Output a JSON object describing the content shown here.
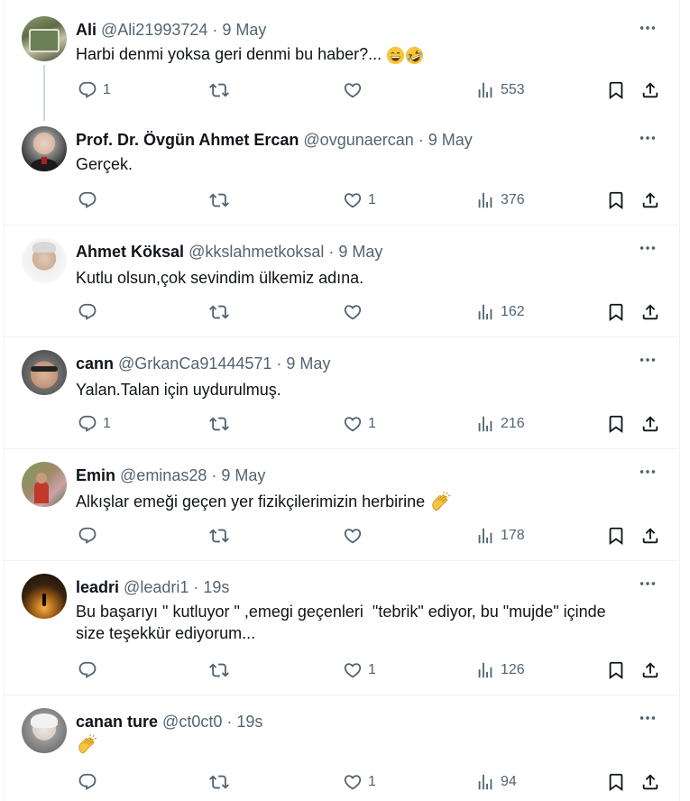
{
  "tweets": [
    {
      "name": "Ali",
      "handle": "@Ali21993724",
      "dot": " · ",
      "time": "9 May",
      "text": "Harbi denmi yoksa geri denmi bu haber?...",
      "emojis": [
        "grinning-face",
        "rolling-laughing-face"
      ],
      "stats": {
        "replies": "1",
        "retweets": "",
        "likes": "",
        "views": "553"
      }
    },
    {
      "name": "Prof. Dr. Övgün Ahmet Ercan",
      "handle": "@ovgunaercan",
      "dot": " · ",
      "time": "9 May",
      "text": "Gerçek.",
      "stats": {
        "replies": "",
        "retweets": "",
        "likes": "1",
        "views": "376"
      }
    },
    {
      "name": "Ahmet Köksal",
      "handle": "@kkslahmetkoksal",
      "dot": " · ",
      "time": "9 May",
      "text": "Kutlu olsun,çok sevindim ülkemiz adına.",
      "stats": {
        "replies": "",
        "retweets": "",
        "likes": "",
        "views": "162"
      }
    },
    {
      "name": "cann",
      "handle": "@GrkanCa91444571",
      "dot": " · ",
      "time": "9 May",
      "text": "Yalan.Talan için uydurulmuş.",
      "stats": {
        "replies": "1",
        "retweets": "",
        "likes": "1",
        "views": "216"
      }
    },
    {
      "name": "Emin",
      "handle": "@eminas28",
      "dot": " · ",
      "time": "9 May",
      "text": "Alkışlar emeği geçen yer fizikçilerimizin herbirine",
      "emojis": [
        "clapping-hands"
      ],
      "stats": {
        "replies": "",
        "retweets": "",
        "likes": "",
        "views": "178"
      }
    },
    {
      "name": "leadri",
      "handle": "@leadri1",
      "dot": " · ",
      "time": "19s",
      "text_line1": "Bu başarıyı \" kutluyor \" ,emegi geçenleri  \"tebrik\" ediyor, bu \"mujde\" içinde",
      "text_line2": "size teşekkür ediyorum...",
      "stats": {
        "replies": "",
        "retweets": "",
        "likes": "1",
        "views": "126"
      }
    },
    {
      "name": "canan ture",
      "handle": "@ct0ct0",
      "dot": " · ",
      "time": "19s",
      "emojis": [
        "clapping-hands"
      ],
      "stats": {
        "replies": "",
        "retweets": "",
        "likes": "1",
        "views": "94"
      }
    }
  ],
  "icons": {
    "more": "more-horizontal-icon",
    "reply": "reply-bubble-icon",
    "retweet": "retweet-icon",
    "like": "heart-icon",
    "views": "views-chart-icon",
    "bookmark": "bookmark-icon",
    "share": "share-icon"
  },
  "colors": {
    "text": "#0f1419",
    "secondary": "#536471",
    "divider": "#eff3f4",
    "thread": "#cfd9de"
  }
}
